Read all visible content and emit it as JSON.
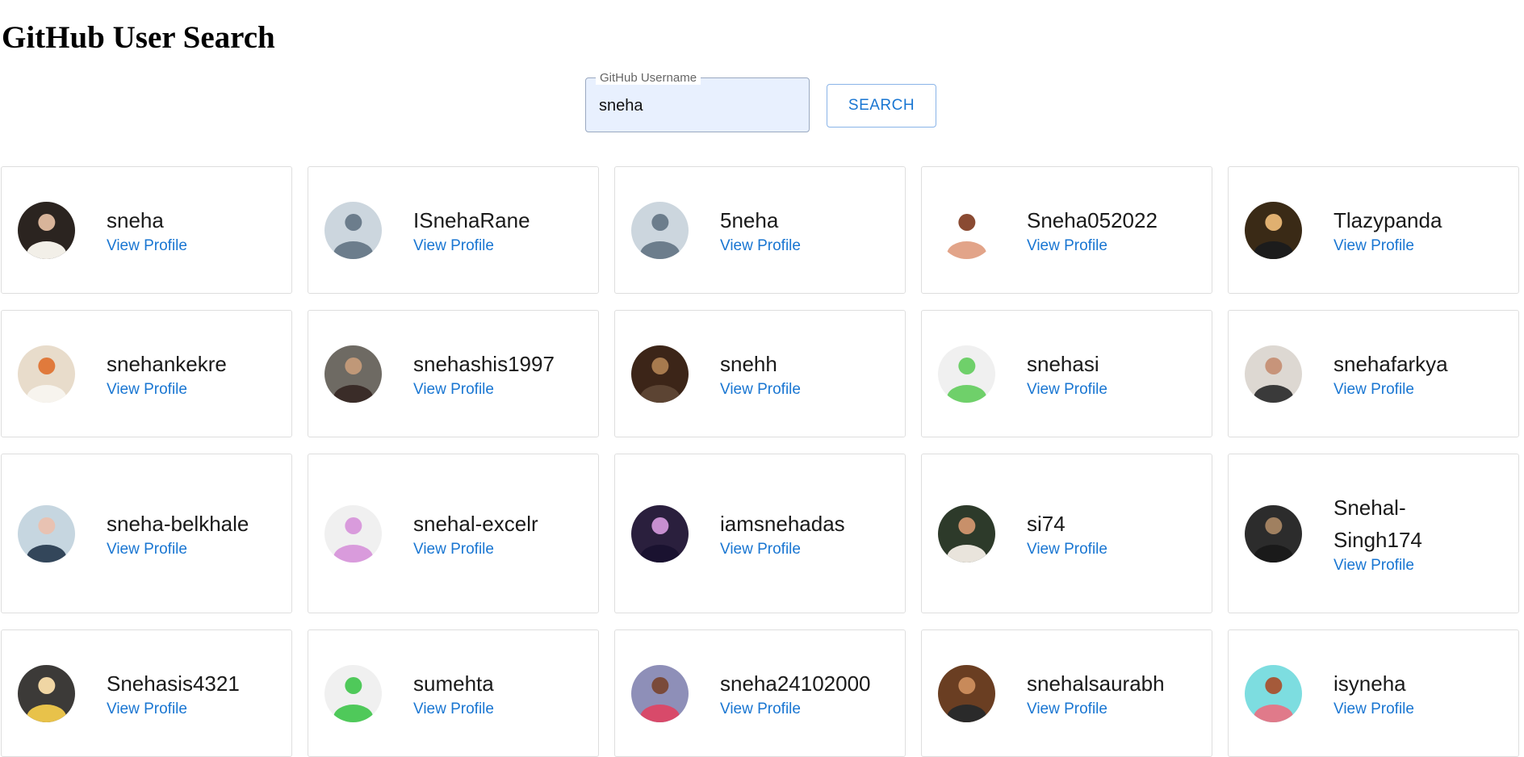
{
  "header": {
    "title": "GitHub User Search"
  },
  "search": {
    "label": "GitHub Username",
    "value": "sneha",
    "button_label": "SEARCH"
  },
  "users": [
    {
      "login": "sneha",
      "link": "View Profile",
      "avatar": {
        "bg": "#2b2420",
        "fg": "#d8b49a",
        "body": "#f2efe8"
      }
    },
    {
      "login": "ISnehaRane",
      "link": "View Profile",
      "avatar": {
        "bg": "#ccd6de",
        "fg": "#6c7d8c",
        "body": "#6c7d8c"
      }
    },
    {
      "login": "5neha",
      "link": "View Profile",
      "avatar": {
        "bg": "#ccd6de",
        "fg": "#6c7d8c",
        "body": "#6c7d8c"
      }
    },
    {
      "login": "Sneha052022",
      "link": "View Profile",
      "avatar": {
        "bg": "#ffffff",
        "fg": "#8a4a32",
        "body": "#e2a489"
      }
    },
    {
      "login": "Tlazypanda",
      "link": "View Profile",
      "avatar": {
        "bg": "#3a2a16",
        "fg": "#e0b070",
        "body": "#1c1c1c"
      }
    },
    {
      "login": "snehankekre",
      "link": "View Profile",
      "avatar": {
        "bg": "#e8dccb",
        "fg": "#e07a3c",
        "body": "#f7f4ee"
      }
    },
    {
      "login": "snehashis1997",
      "link": "View Profile",
      "avatar": {
        "bg": "#6e6a63",
        "fg": "#c09878",
        "body": "#3a2c28"
      }
    },
    {
      "login": "snehh",
      "link": "View Profile",
      "avatar": {
        "bg": "#3c2518",
        "fg": "#a77a4e",
        "body": "#5c4433"
      }
    },
    {
      "login": "snehasi",
      "link": "View Profile",
      "avatar": {
        "bg": "#f0f0f0",
        "fg": "#6fd06a",
        "body": "#6fd06a"
      }
    },
    {
      "login": "snehafarkya",
      "link": "View Profile",
      "avatar": {
        "bg": "#ddd8d2",
        "fg": "#c7947a",
        "body": "#3a3a3a"
      }
    },
    {
      "login": "sneha-belkhale",
      "link": "View Profile",
      "avatar": {
        "bg": "#c6d6e0",
        "fg": "#e8c2b2",
        "body": "#33465a"
      }
    },
    {
      "login": "snehal-excelr",
      "link": "View Profile",
      "avatar": {
        "bg": "#f0f0f0",
        "fg": "#d99bdc",
        "body": "#d99bdc"
      }
    },
    {
      "login": "iamsnehadas",
      "link": "View Profile",
      "avatar": {
        "bg": "#2a1f3d",
        "fg": "#c78fd0",
        "body": "#1a1230"
      }
    },
    {
      "login": "si74",
      "link": "View Profile",
      "avatar": {
        "bg": "#2d3a2a",
        "fg": "#c8906a",
        "body": "#e9e4dc"
      }
    },
    {
      "login": "Snehal-Singh174",
      "link": "View Profile",
      "avatar": {
        "bg": "#2c2c2c",
        "fg": "#a08060",
        "body": "#1a1a1a"
      }
    },
    {
      "login": "Snehasis4321",
      "link": "View Profile",
      "avatar": {
        "bg": "#3c3a38",
        "fg": "#f0d6a4",
        "body": "#e8c24a"
      }
    },
    {
      "login": "sumehta",
      "link": "View Profile",
      "avatar": {
        "bg": "#f0f0f0",
        "fg": "#4fc95a",
        "body": "#4fc95a"
      }
    },
    {
      "login": "sneha24102000",
      "link": "View Profile",
      "avatar": {
        "bg": "#8e8fb8",
        "fg": "#7a4a3a",
        "body": "#d84a6a"
      }
    },
    {
      "login": "snehalsaurabh",
      "link": "View Profile",
      "avatar": {
        "bg": "#6a3e22",
        "fg": "#c88a5a",
        "body": "#2a2a2a"
      }
    },
    {
      "login": "isyneha",
      "link": "View Profile",
      "avatar": {
        "bg": "#7ddde0",
        "fg": "#a55a3a",
        "body": "#e07a8a"
      }
    }
  ]
}
